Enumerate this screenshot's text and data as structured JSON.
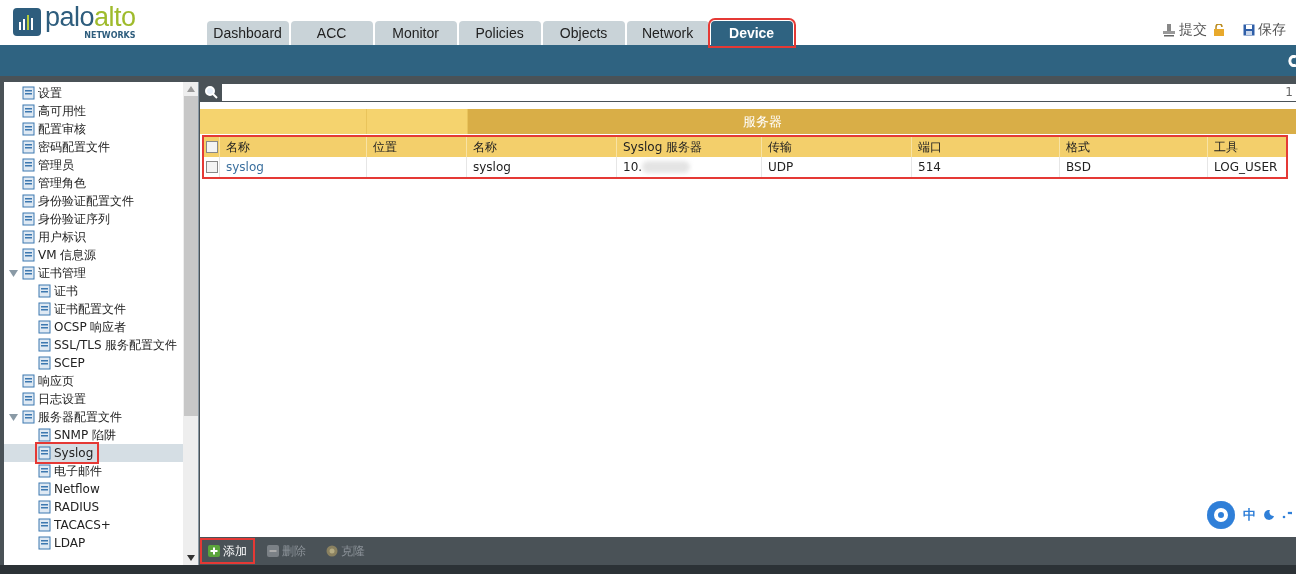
{
  "logo": {
    "word_1": "palo",
    "word_2": "alto",
    "subtitle": "NETWORKS"
  },
  "tabs": [
    {
      "label": "Dashboard",
      "selected": false,
      "highlighted": false
    },
    {
      "label": "ACC",
      "selected": false,
      "highlighted": false
    },
    {
      "label": "Monitor",
      "selected": false,
      "highlighted": false
    },
    {
      "label": "Policies",
      "selected": false,
      "highlighted": false
    },
    {
      "label": "Objects",
      "selected": false,
      "highlighted": false
    },
    {
      "label": "Network",
      "selected": false,
      "highlighted": false
    },
    {
      "label": "Device",
      "selected": true,
      "highlighted": true
    }
  ],
  "header_actions": [
    {
      "kind": "commit",
      "label": "提交"
    },
    {
      "kind": "lock"
    },
    {
      "kind": "save",
      "label": "保存"
    }
  ],
  "sidebar": {
    "items": [
      {
        "label": "设置",
        "selected": false,
        "highlighted": false
      },
      {
        "label": "高可用性",
        "selected": false,
        "highlighted": false
      },
      {
        "label": "配置审核",
        "selected": false,
        "highlighted": false
      },
      {
        "label": "密码配置文件",
        "selected": false,
        "highlighted": false
      },
      {
        "label": "管理员",
        "selected": false,
        "highlighted": false
      },
      {
        "label": "管理角色",
        "selected": false,
        "highlighted": false
      },
      {
        "label": "身份验证配置文件",
        "selected": false,
        "highlighted": false
      },
      {
        "label": "身份验证序列",
        "selected": false,
        "highlighted": false
      },
      {
        "label": "用户标识",
        "selected": false,
        "highlighted": false
      },
      {
        "label": "VM 信息源",
        "selected": false,
        "highlighted": false
      },
      {
        "label": "证书管理",
        "selected": false,
        "highlighted": false,
        "expanded": true,
        "children": [
          {
            "label": "证书",
            "selected": false,
            "highlighted": false
          },
          {
            "label": "证书配置文件",
            "selected": false,
            "highlighted": false
          },
          {
            "label": "OCSP 响应者",
            "selected": false,
            "highlighted": false
          },
          {
            "label": "SSL/TLS 服务配置文件",
            "selected": false,
            "highlighted": false
          },
          {
            "label": "SCEP",
            "selected": false,
            "highlighted": false
          }
        ]
      },
      {
        "label": "响应页",
        "selected": false,
        "highlighted": false
      },
      {
        "label": "日志设置",
        "selected": false,
        "highlighted": false
      },
      {
        "label": "服务器配置文件",
        "selected": false,
        "highlighted": false,
        "expanded": true,
        "children": [
          {
            "label": "SNMP 陷阱",
            "selected": false,
            "highlighted": false
          },
          {
            "label": "Syslog",
            "selected": true,
            "highlighted": true
          },
          {
            "label": "电子邮件",
            "selected": false,
            "highlighted": false
          },
          {
            "label": "Netflow",
            "selected": false,
            "highlighted": false
          },
          {
            "label": "RADIUS",
            "selected": false,
            "highlighted": false
          },
          {
            "label": "TACACS+",
            "selected": false,
            "highlighted": false
          },
          {
            "label": "LDAP",
            "selected": false,
            "highlighted": false
          }
        ]
      }
    ]
  },
  "search": {
    "count": "1"
  },
  "table": {
    "group_heading": "服务器",
    "highlighted": true,
    "columns": [
      "名称",
      "位置",
      "名称",
      "Syslog 服务器",
      "传输",
      "端口",
      "格式",
      "工具"
    ],
    "rows": [
      {
        "checked": false,
        "cells": [
          "syslog",
          "",
          "syslog",
          "10.",
          "UDP",
          "514",
          "BSD",
          "LOG_USER"
        ]
      }
    ]
  },
  "actions": [
    {
      "label": "添加",
      "disabled": false,
      "highlighted": true
    },
    {
      "label": "删除",
      "disabled": true,
      "highlighted": false
    },
    {
      "label": "克隆",
      "disabled": true,
      "highlighted": false
    }
  ],
  "ime_bar": {
    "label": "中"
  }
}
